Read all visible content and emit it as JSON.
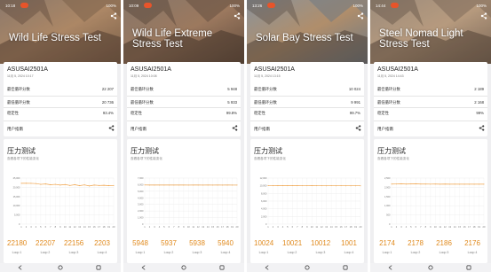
{
  "panels": [
    {
      "status_time": "10:18",
      "battery": "100%",
      "title_lines": [
        "Wild Life Stress Test"
      ],
      "device": "ASUSAI2501A",
      "date": "11月 5, 2024 10:17",
      "best_label": "最佳循环分数",
      "best_value": "22 207",
      "lowest_label": "最低循环分数",
      "lowest_value": "20 736",
      "stability_label": "稳定性",
      "stability_value": "93.4%",
      "user_guide": "用户指南",
      "section_title": "压力测试",
      "section_sub": "查看各项下的性能变化",
      "loops": [
        {
          "value": "22180",
          "label": "Loop 1"
        },
        {
          "value": "22207",
          "label": "Loop 2"
        },
        {
          "value": "22156",
          "label": "Loop 3"
        },
        {
          "value": "2203",
          "label": "Loop 4"
        }
      ],
      "chart_data": {
        "type": "line",
        "y_ticks": [
          "25,000",
          "20,000",
          "15,000",
          "10,000",
          "5,000",
          "0"
        ],
        "ylim": [
          0,
          25000
        ],
        "x_ticks": [
          "1",
          "2",
          "3",
          "4",
          "5",
          "6",
          "7",
          "8",
          "9",
          "10",
          "11",
          "12",
          "13",
          "14",
          "15",
          "16",
          "17",
          "18",
          "19",
          "20"
        ],
        "series": [
          {
            "values": [
              22180,
              22207,
              22156,
              22030,
              21600,
              21800,
              21400,
              21600,
              21200,
              21500,
              21000,
              21400,
              20900,
              21300,
              20736,
              21200,
              21000,
              21100,
              20900,
              21000
            ]
          }
        ],
        "line_color": "#f0a34a"
      }
    },
    {
      "status_time": "10:09",
      "battery": "100%",
      "title_lines": [
        "Wild Life Extreme",
        "Stress Test"
      ],
      "device": "ASUSAI2501A",
      "date": "11月 5, 2024 10:08",
      "best_label": "最佳循环分数",
      "best_value": "5 948",
      "lowest_label": "最低循环分数",
      "lowest_value": "5 933",
      "stability_label": "稳定性",
      "stability_value": "99.8%",
      "user_guide": "用户指南",
      "section_title": "压力测试",
      "section_sub": "查看各项下的性能变化",
      "loops": [
        {
          "value": "5948",
          "label": "Loop 1"
        },
        {
          "value": "5937",
          "label": "Loop 2"
        },
        {
          "value": "5938",
          "label": "Loop 3"
        },
        {
          "value": "5940",
          "label": "Loop 4"
        }
      ],
      "chart_data": {
        "type": "line",
        "y_ticks": [
          "7,000",
          "6,000",
          "5,000",
          "4,000",
          "3,000",
          "2,000",
          "1,000",
          "0"
        ],
        "ylim": [
          0,
          7000
        ],
        "x_ticks": [
          "1",
          "2",
          "3",
          "4",
          "5",
          "6",
          "7",
          "8",
          "9",
          "10",
          "11",
          "12",
          "13",
          "14",
          "15",
          "16",
          "17",
          "18",
          "19",
          "20"
        ],
        "series": [
          {
            "values": [
              5948,
              5937,
              5938,
              5940,
              5939,
              5936,
              5938,
              5935,
              5937,
              5934,
              5936,
              5935,
              5934,
              5936,
              5933,
              5935,
              5934,
              5935,
              5933,
              5934
            ]
          }
        ],
        "line_color": "#f0a34a"
      }
    },
    {
      "status_time": "13:26",
      "battery": "100%",
      "title_lines": [
        "Solar Bay Stress Test"
      ],
      "device": "ASUSAI2501A",
      "date": "11月 5, 2024 13:15",
      "best_label": "最佳循环分数",
      "best_value": "10 024",
      "lowest_label": "最低循环分数",
      "lowest_value": "9 991",
      "stability_label": "稳定性",
      "stability_value": "99.7%",
      "user_guide": "用户指南",
      "section_title": "压力测试",
      "section_sub": "查看各项下的性能变化",
      "loops": [
        {
          "value": "10024",
          "label": "Loop 1"
        },
        {
          "value": "10021",
          "label": "Loop 2"
        },
        {
          "value": "10012",
          "label": "Loop 3"
        },
        {
          "value": "1001",
          "label": "Loop 4"
        }
      ],
      "chart_data": {
        "type": "line",
        "y_ticks": [
          "12,000",
          "10,000",
          "8,000",
          "6,000",
          "4,000",
          "2,000",
          "0"
        ],
        "ylim": [
          0,
          12000
        ],
        "x_ticks": [
          "1",
          "2",
          "3",
          "4",
          "5",
          "6",
          "7",
          "8",
          "9",
          "10",
          "11",
          "12",
          "13",
          "14",
          "15",
          "16",
          "17",
          "18",
          "19",
          "20"
        ],
        "series": [
          {
            "values": [
              10024,
              10021,
              10012,
              10010,
              10005,
              10008,
              10002,
              10000,
              9998,
              10001,
              9996,
              9999,
              9995,
              9997,
              9993,
              9996,
              9991,
              9995,
              9993,
              9994
            ]
          }
        ],
        "line_color": "#f0a34a"
      }
    },
    {
      "status_time": "14:44",
      "battery": "100%",
      "title_lines": [
        "Steel Nomad Light",
        "Stress Test"
      ],
      "device": "ASUSAI2501A",
      "date": "11月 5, 2024 14:43",
      "best_label": "最佳循环分数",
      "best_value": "2 189",
      "lowest_label": "最低循环分数",
      "lowest_value": "2 168",
      "stability_label": "稳定性",
      "stability_value": "99%",
      "user_guide": "用户指南",
      "section_title": "压力测试",
      "section_sub": "查看各项下的性能变化",
      "loops": [
        {
          "value": "2174",
          "label": "Loop 1"
        },
        {
          "value": "2178",
          "label": "Loop 2"
        },
        {
          "value": "2186",
          "label": "Loop 3"
        },
        {
          "value": "2176",
          "label": "Loop 4"
        }
      ],
      "chart_data": {
        "type": "line",
        "y_ticks": [
          "2,500",
          "2,000",
          "1,500",
          "1,000",
          "500",
          "0"
        ],
        "ylim": [
          0,
          2500
        ],
        "x_ticks": [
          "1",
          "2",
          "3",
          "4",
          "5",
          "6",
          "7",
          "8",
          "9",
          "10",
          "11",
          "12",
          "13",
          "14",
          "15",
          "16",
          "17",
          "18",
          "19",
          "20"
        ],
        "series": [
          {
            "values": [
              2174,
              2178,
              2186,
              2176,
              2180,
              2189,
              2175,
              2178,
              2172,
              2177,
              2170,
              2175,
              2169,
              2173,
              2168,
              2172,
              2170,
              2171,
              2169,
              2170
            ]
          }
        ],
        "line_color": "#f0a34a"
      }
    }
  ],
  "colors": {
    "accent_orange": "#e08a1e",
    "status_pill": "#e8542a"
  },
  "icons": [
    "share-icon",
    "back-icon",
    "home-icon",
    "recents-icon"
  ]
}
